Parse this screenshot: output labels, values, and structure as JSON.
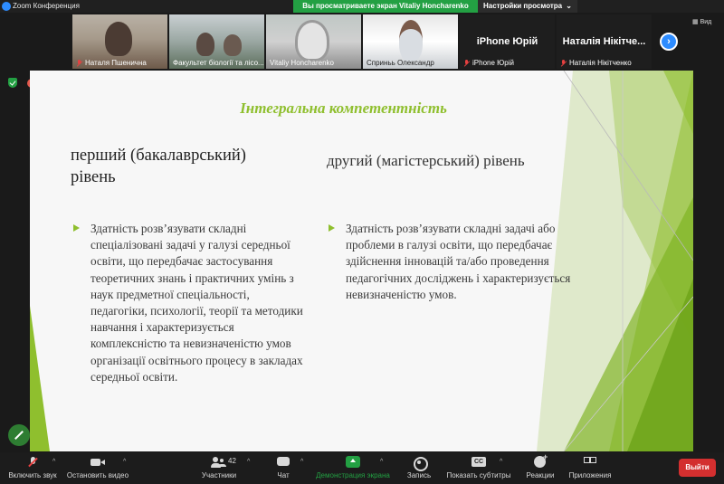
{
  "titlebar": {
    "app_title": "Zoom Конференция",
    "share_banner": "Вы просматриваете экран Vitaliy Honcharenko",
    "view_settings": "Настройки просмотра",
    "view_settings_chevron": "⌄"
  },
  "participants": [
    {
      "name": "Наталя Пшенична",
      "muted": true,
      "video": true
    },
    {
      "name": "Факультет біології та лісо...",
      "muted": false,
      "video": true
    },
    {
      "name": "Vitaliy Honcharenko",
      "muted": false,
      "video": true
    },
    {
      "name": "Сприньь Олександр",
      "muted": false,
      "video": true
    },
    {
      "name": "iPhone Юрій",
      "display_name": "iPhone Юрій",
      "muted": true,
      "video": false
    },
    {
      "name": "Наталія Нікітченко",
      "display_name": "Наталія Нікітче...",
      "muted": true,
      "video": false
    }
  ],
  "side_panel": {
    "view_label": "Вид",
    "next_page": "›"
  },
  "slide": {
    "title": "Інтегральна компетентність",
    "left_heading": "перший (бакалаврський) рівень",
    "right_heading": "другий (магістерський) рівень",
    "left_text": "Здатність розв’язувати складні спеціалізовані задачі у галузі середньої освіти, що передбачає застосування теоретичних знань і практичних умінь з наук предметної спеціальності, педагогіки, психології, теорії та методики навчання і характеризується комплексністю та невизначеністю умов організації освітнього процесу в закладах середньої освіти.",
    "right_text": "Здатність розв’язувати складні задачі або проблеми в галузі освіти, що передбачає здійснення інновацій та/або проведення педагогічних досліджень і характеризується невизначеністю умов.",
    "accent_color": "#8fbf2e"
  },
  "toolbar": {
    "mute_label": "Включить звук",
    "video_label": "Остановить видео",
    "participants_label": "Участники",
    "participants_count": "42",
    "chat_label": "Чат",
    "share_label": "Демонстрация экрана",
    "record_label": "Запись",
    "captions_label": "Показать субтитры",
    "reactions_label": "Реакции",
    "apps_label": "Приложения",
    "leave_label": "Выйти",
    "caret": "^"
  },
  "icons": [
    "zoom-logo-icon",
    "shield-check-icon",
    "recording-icon",
    "mic-off-icon",
    "camera-icon",
    "participants-icon",
    "chat-icon",
    "share-screen-icon",
    "record-icon",
    "captions-icon",
    "reactions-icon",
    "apps-icon",
    "annotate-pen-icon",
    "grid-view-icon",
    "chevron-right-icon"
  ],
  "colors": {
    "share_green": "#23a043",
    "zoom_blue": "#2d8cff",
    "leave_red": "#d32f2f",
    "slide_green": "#8fbf2e"
  }
}
